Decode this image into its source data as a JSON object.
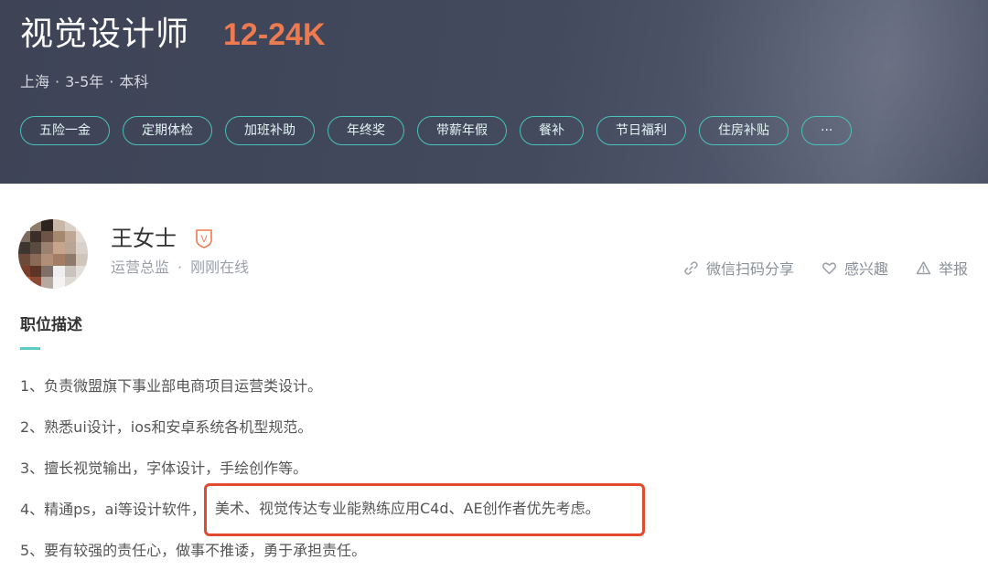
{
  "job": {
    "title": "视觉设计师",
    "salary": "12-24K",
    "location": "上海",
    "experience": "3-5年",
    "education": "本科",
    "separator": "·",
    "benefits": [
      "五险一金",
      "定期体检",
      "加班补助",
      "年终奖",
      "带薪年假",
      "餐补",
      "节日福利",
      "住房补贴",
      "···"
    ]
  },
  "recruiter": {
    "name": "王女士",
    "position": "运营总监",
    "separator": "·",
    "status": "刚刚在线",
    "verified_badge": "V"
  },
  "actions": {
    "share": "微信扫码分享",
    "interest": "感兴趣",
    "report": "举报"
  },
  "description": {
    "title": "职位描述",
    "lines": [
      "1、负责微盟旗下事业部电商项目运营类设计。",
      "2、熟悉ui设计，ios和安卓系统各机型规范。",
      "3、擅长视觉输出，字体设计，手绘创作等。",
      "4、精通ps，ai等设计软件，",
      "5、要有较强的责任心，做事不推诿，勇于承担责任。"
    ],
    "highlighted": "美术、视觉传达专业能熟练应用C4d、AE创作者优先考虑。"
  },
  "colors": {
    "header_bg": "#3e4356",
    "salary": "#ee7a4f",
    "tag_border": "#48c2bd",
    "accent": "#5ccbc6",
    "highlight_box": "#e24a2f"
  },
  "icons": [
    "shield-v-icon",
    "link-icon",
    "heart-icon",
    "warning-icon"
  ]
}
